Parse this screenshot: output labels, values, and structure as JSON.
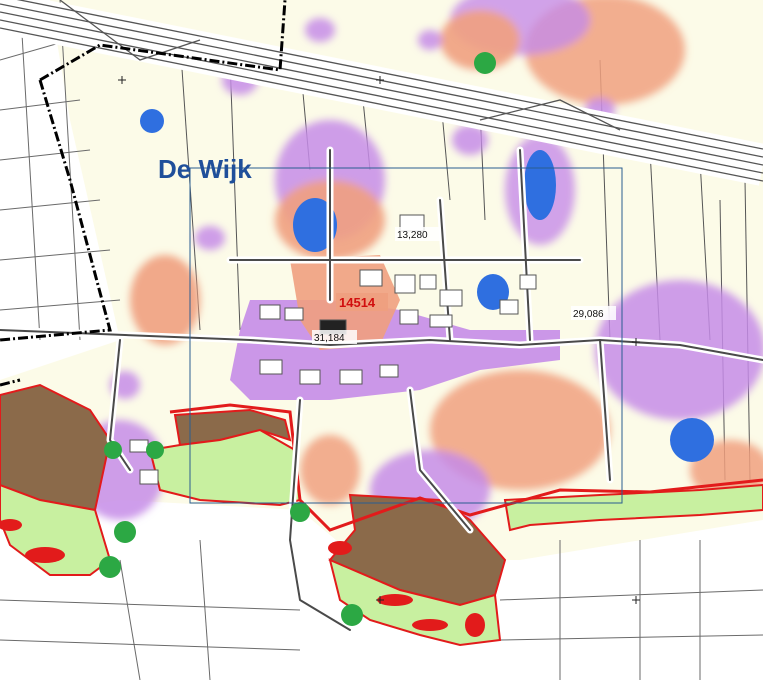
{
  "map": {
    "place_name": "De Wijk",
    "area_code": "14514",
    "labels": {
      "north": "13,280",
      "center": "31,184",
      "east": "29,086"
    },
    "colors": {
      "background": "#fcfbe8",
      "road": "#4a4a4a",
      "road_outline": "#ffffff",
      "urban_fill": "#c58ce8",
      "salmon_zone": "#f0a07f",
      "blue_zone": "#2f6fe0",
      "brown_zone": "#8b6a4a",
      "green_zone": "#c8f0a0",
      "red_line": "#e21b1b",
      "green_dot": "#2ca844",
      "boundary": "#000000",
      "frame": "#2a5d91"
    }
  }
}
